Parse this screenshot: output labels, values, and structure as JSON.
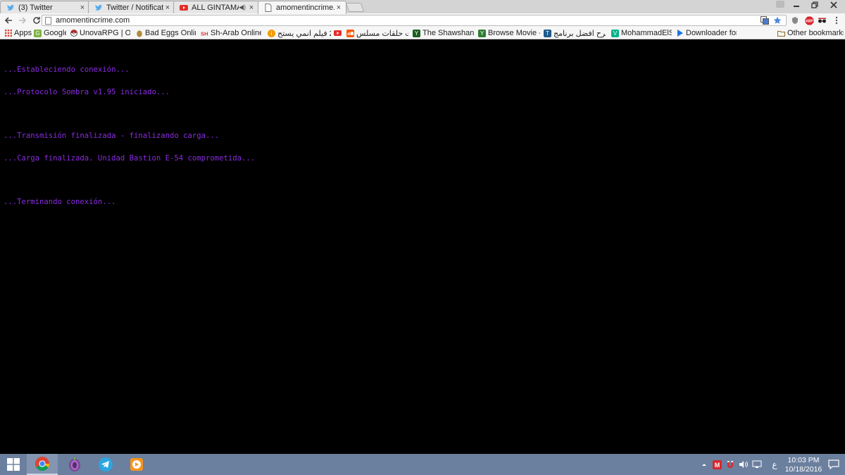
{
  "browser": {
    "tabs": [
      {
        "title": "(3) Twitter",
        "icon": "twitter-bird-icon",
        "active": false
      },
      {
        "title": "Twitter / Notificatio",
        "icon": "twitter-bird-icon",
        "active": false
      },
      {
        "title": "ALL GINTAMA OF",
        "icon": "youtube-icon",
        "active": false,
        "audio": "◀)"
      },
      {
        "title": "amomentincrime.cc",
        "icon": "page-icon",
        "active": true
      }
    ],
    "close_glyph": "×",
    "url": "amomentincrime.com",
    "bookmarks": [
      {
        "label": "Apps",
        "icon": "apps-grid-icon",
        "color": "#d64937"
      },
      {
        "label": "Google",
        "icon": "google-icon",
        "color": "#7cb342"
      },
      {
        "label": "UnovaRPG | Onlin",
        "icon": "pokeball-icon",
        "color": "#c62828"
      },
      {
        "label": "Bad Eggs Online",
        "icon": "egg-icon",
        "color": "#b08a3c"
      },
      {
        "label": "Sh-Arab Online M",
        "icon": "sh-logo-icon",
        "color": "#d32f2f"
      },
      {
        "label": "22 فيلم انمي يستح",
        "icon": "info-orange-icon",
        "color": "#f59b00"
      },
      {
        "label": "",
        "icon": "youtube-icon",
        "color": "#e52d27"
      },
      {
        "label": "تورنت حلقات مسلس",
        "icon": "soundcloud-icon",
        "color": "#ff5500"
      },
      {
        "label": "The Shawshank R",
        "icon": "imdb-green-icon",
        "color": "#1b5e20"
      },
      {
        "label": "Browse Movie - Y",
        "icon": "yts-icon",
        "color": "#2e7d32"
      },
      {
        "label": "شرح افضل برنامج",
        "icon": "tag-blue-icon",
        "color": "#1e5b8c"
      },
      {
        "label": "MohammadElSaf",
        "icon": "vine-icon",
        "color": "#00b489"
      },
      {
        "label": "Downloader for S",
        "icon": "play-arrow-icon",
        "color": "#1a73e8"
      },
      {
        "label": "Other bookmarks",
        "icon": "folder-icon",
        "color": "#e0b040"
      }
    ]
  },
  "terminal": {
    "color": "#8a2be2",
    "blocks": [
      [
        "...Estableciendo conexión...",
        "...Protocolo Sombra v1.95 iniciado..."
      ],
      [
        "...Transmisión finalizada - finalizando carga...",
        "...Carga finalizada. Unidad Bastion E-54 comprometida..."
      ],
      [
        "...Terminando conexión..."
      ]
    ]
  },
  "taskbar": {
    "apps": [
      {
        "name": "chrome-app",
        "icon": "chrome-icon",
        "active": true
      },
      {
        "name": "tor-app",
        "icon": "tor-onion-icon",
        "active": false
      },
      {
        "name": "telegram-app",
        "icon": "telegram-icon",
        "active": false
      },
      {
        "name": "media-player-app",
        "icon": "vlc-play-icon",
        "active": false
      }
    ],
    "input_language": "ع",
    "time": "10:03 PM",
    "date": "10/18/2016"
  }
}
